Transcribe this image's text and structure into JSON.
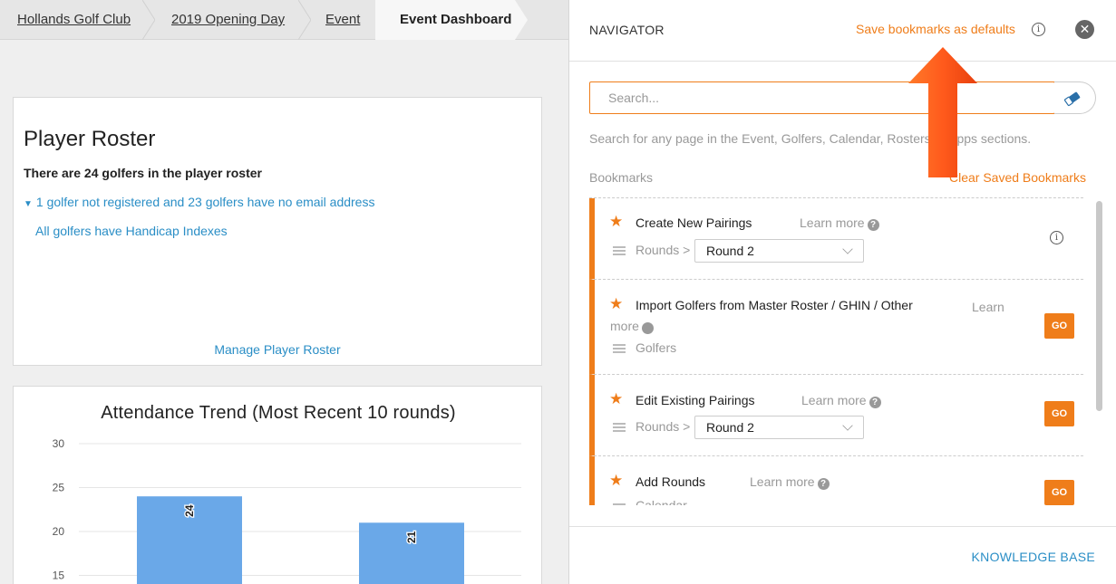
{
  "breadcrumb": {
    "items": [
      "Hollands Golf Club",
      "2019 Opening Day",
      "Event"
    ],
    "current": "Event Dashboard"
  },
  "roster": {
    "title": "Player Roster",
    "count_text": "There are 24 golfers in the player roster",
    "warning_text": "1 golfer not registered and 23 golfers have no email address",
    "handicap_text": "All golfers have Handicap Indexes",
    "manage_link": "Manage Player Roster"
  },
  "attendance": {
    "title": "Attendance Trend (Most Recent 10 rounds)"
  },
  "chart_data": {
    "type": "bar",
    "title": "Attendance Trend (Most Recent 10 rounds)",
    "categories": [
      "",
      ""
    ],
    "values": [
      24,
      21
    ],
    "y_ticks": [
      "30",
      "25",
      "20",
      "15"
    ],
    "ylim": [
      15,
      30
    ],
    "grid": true,
    "bar_color": "#6aa8e8"
  },
  "navigator": {
    "title": "NAVIGATOR",
    "save_defaults": "Save bookmarks as defaults",
    "close_icon": "close-icon",
    "search_placeholder": "Search...",
    "search_hint": "Search for any page in the Event, Golfers, Calendar, Rosters or Apps sections.",
    "bookmarks_label": "Bookmarks",
    "clear_saved": "Clear Saved Bookmarks",
    "knowledge_base": "KNOWLEDGE BASE",
    "bookmarks": [
      {
        "title": "Create New Pairings",
        "learn": "Learn more",
        "meta": "Rounds >",
        "select": "Round 2",
        "action": "info"
      },
      {
        "title": "Import Golfers from Master Roster / GHIN / Other",
        "learn": "Learn more",
        "meta": "Golfers",
        "action": "GO"
      },
      {
        "title": "Edit Existing Pairings",
        "learn": "Learn more",
        "meta": "Rounds >",
        "select": "Round 2",
        "action": "GO"
      },
      {
        "title": "Add Rounds",
        "learn": "Learn more",
        "meta": "Calendar",
        "action": "GO"
      }
    ]
  },
  "colors": {
    "accent": "#ef7d1a",
    "link": "#2a8ec6",
    "bar": "#6aa8e8"
  }
}
